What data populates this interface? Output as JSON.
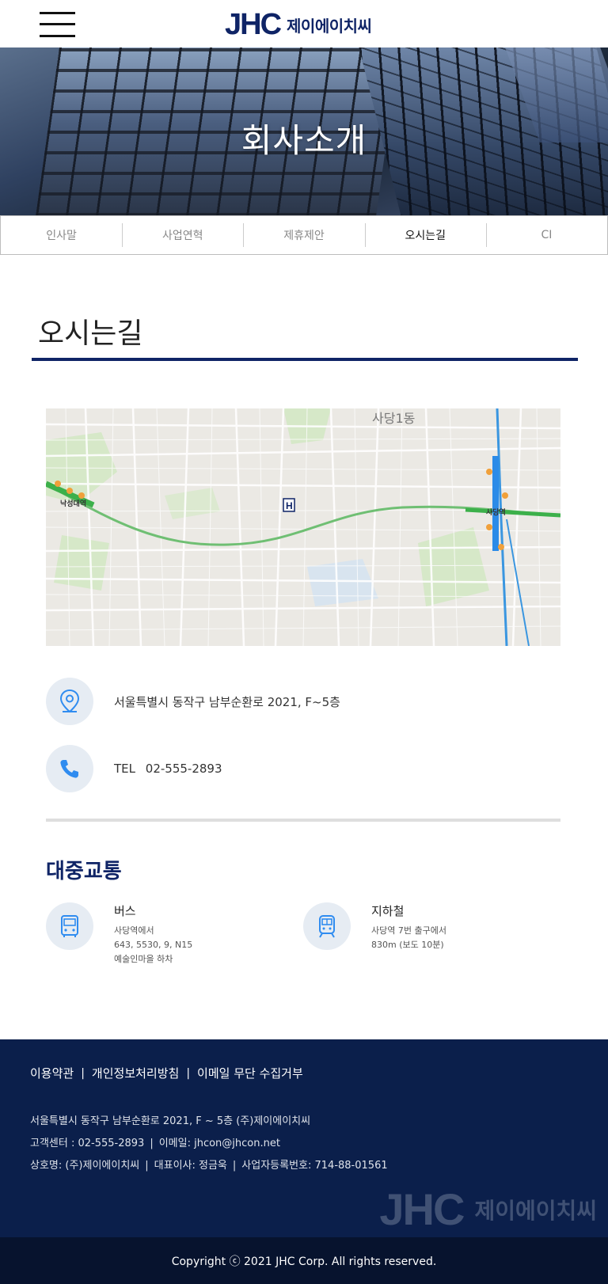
{
  "header": {
    "menu_icon": "hamburger-menu-icon",
    "logo_mark": "JHC",
    "logo_text": "제이에이치씨"
  },
  "hero": {
    "title": "회사소개"
  },
  "tabs": [
    {
      "label": "인사말"
    },
    {
      "label": "사업연혁"
    },
    {
      "label": "제휴제안"
    },
    {
      "label": "오시는길",
      "active": true
    },
    {
      "label": "CI"
    }
  ],
  "page": {
    "title": "오시는길"
  },
  "map": {
    "labels": {
      "area": "사당1동",
      "station_left": "낙성대역",
      "station_right": "사당역"
    }
  },
  "contact": {
    "address": "서울특별시 동작구 남부순환로 2021, F~5층",
    "tel_label": "TEL",
    "tel_number": "02-555-2893"
  },
  "transport": {
    "title": "대중교통",
    "bus": {
      "heading": "버스",
      "lines": [
        "사당역에서",
        "643, 5530, 9, N15",
        "예술인마을 하차"
      ]
    },
    "subway": {
      "heading": "지하철",
      "lines": [
        "사당역 7번 출구에서",
        "830m (보도 10분)"
      ]
    }
  },
  "footer": {
    "links": [
      "이용약관",
      "개인정보처리방침",
      "이메일 무단 수집거부"
    ],
    "address_line": "서울특별시 동작구 남부순환로 2021, F ~ 5층 (주)제이에이치씨",
    "customer_center": "고객센터 : 02-555-2893",
    "email": "이메일: jhcon@jhcon.net",
    "company_name": "상호명: (주)제이에이치씨",
    "ceo": "대표이사: 정금욱",
    "business_no": "사업자등록번호: 714-88-01561",
    "logo_mark": "JHC",
    "logo_text": "제이에이치씨",
    "copyright": "Copyright ⓒ 2021 JHC Corp. All rights reserved."
  },
  "colors": {
    "brand_navy": "#0f2466",
    "footer_bg": "#0b1f4b",
    "copyright_bg": "#07132e",
    "icon_blue": "#2f8cf0"
  }
}
